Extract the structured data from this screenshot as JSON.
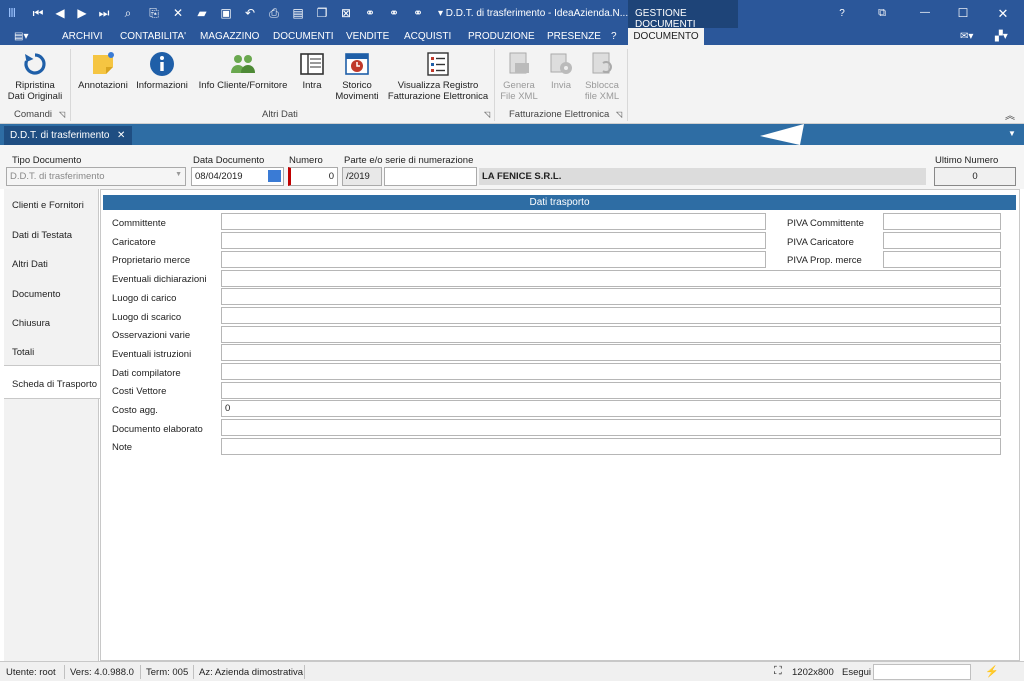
{
  "window": {
    "title": "▾  D.D.T. di trasferimento - IdeaAzienda.N...",
    "context_group": "GESTIONE DOCUMENTI",
    "help_glyph": "?",
    "restore_glyph": "⧉",
    "min_glyph": "—",
    "max_glyph": "☐",
    "close_glyph": "✕"
  },
  "menubar": {
    "app_menu": "▤▾",
    "items": [
      "ARCHIVI",
      "CONTABILITA'",
      "MAGAZZINO",
      "DOCUMENTI",
      "VENDITE",
      "ACQUISTI",
      "PRODUZIONE",
      "PRESENZE",
      "?"
    ],
    "active": "DOCUMENTO",
    "mail_glyph": "✉▾",
    "layout_glyph": "▞▾"
  },
  "ribbon": {
    "groups": [
      "Comandi",
      "Altri Dati",
      "Fatturazione Elettronica"
    ],
    "buttons": {
      "ripristina": "Ripristina\nDati Originali",
      "annotazioni": "Annotazioni",
      "informazioni": "Informazioni",
      "info_cliente": "Info Cliente/Fornitore",
      "intra": "Intra",
      "storico": "Storico\nMovimenti",
      "registro": "Visualizza Registro\nFatturazione Elettronica",
      "genera": "Genera\nFile XML",
      "invia": "Invia",
      "sblocca": "Sblocca\nfile XML"
    },
    "collapse_glyph": "︽"
  },
  "doc_tab": {
    "label": "D.D.T. di trasferimento",
    "close": "✕"
  },
  "header": {
    "tipo_label": "Tipo Documento",
    "tipo_value": "D.D.T. di trasferimento",
    "data_label": "Data Documento",
    "data_value": "08/04/2019",
    "numero_label": "Numero",
    "numero_value": "0",
    "serie_label": "Parte e/o serie di numerazione",
    "serie_value": "/2019",
    "serie_extra": "",
    "company": "LA FENICE S.R.L.",
    "ultimo_label": "Ultimo Numero",
    "ultimo_value": "0"
  },
  "sidebar": {
    "items": [
      "Clienti e Fornitori",
      "Dati di Testata",
      "Altri Dati",
      "Documento",
      "Chiusura",
      "Totali",
      "Scheda di Trasporto"
    ]
  },
  "section": {
    "title": "Dati trasporto"
  },
  "fields": [
    {
      "label": "Committente",
      "value": ""
    },
    {
      "label": "Caricatore",
      "value": ""
    },
    {
      "label": "Proprietario merce",
      "value": ""
    },
    {
      "label": "Eventuali dichiarazioni",
      "value": ""
    },
    {
      "label": "Luogo di carico",
      "value": ""
    },
    {
      "label": "Luogo di scarico",
      "value": ""
    },
    {
      "label": "Osservazioni varie",
      "value": ""
    },
    {
      "label": "Eventuali istruzioni",
      "value": ""
    },
    {
      "label": "Dati compilatore",
      "value": ""
    },
    {
      "label": "Costi Vettore",
      "value": ""
    },
    {
      "label": "Costo agg.",
      "value": "0"
    },
    {
      "label": "Documento elaborato",
      "value": ""
    },
    {
      "label": "Note",
      "value": ""
    }
  ],
  "piva": [
    {
      "label": "PIVA Committente",
      "value": ""
    },
    {
      "label": "PIVA Caricatore",
      "value": ""
    },
    {
      "label": "PIVA Prop. merce",
      "value": ""
    }
  ],
  "status": {
    "utente": "Utente: root",
    "vers": "Vers: 4.0.988.0",
    "term": "Term: 005",
    "az": "Az: Azienda dimostrativa",
    "resolution": "1202x800",
    "esegui": "Esegui",
    "esegui_value": "",
    "bolt": "⚡"
  },
  "colors": {
    "title": "#2b579a",
    "tabstrip": "#2e6da4",
    "accent_red": "#c00000"
  }
}
